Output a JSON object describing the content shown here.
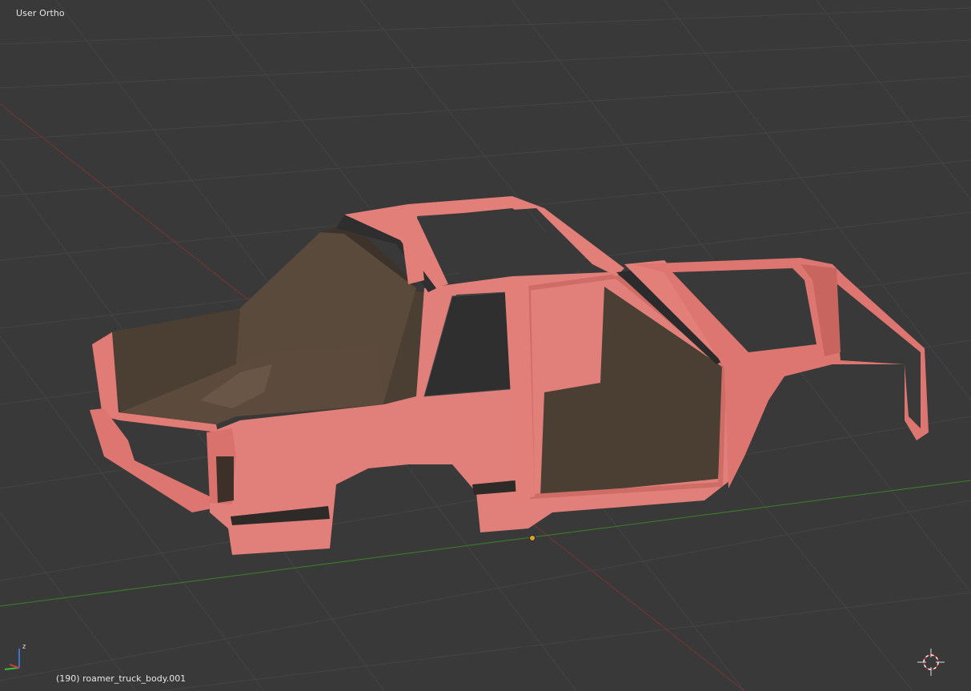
{
  "viewport": {
    "view_label": "User Ortho",
    "object_label": "(190) roamer_truck_body.001",
    "background_color": "#393939",
    "grid_color": "#4a4a4a",
    "x_axis_color": "#8a3a3a",
    "y_axis_color": "#3f8a2e",
    "mesh_color": "#e07a74",
    "interior_color": "#4a3d33",
    "origin_color": "#e0a030"
  },
  "gizmo": {
    "z_label": "z",
    "x_axis_icon": "axis-x-icon",
    "y_axis_icon": "axis-y-icon",
    "z_axis_icon": "axis-z-icon"
  },
  "cursor": {
    "icon": "3d-cursor-icon"
  }
}
